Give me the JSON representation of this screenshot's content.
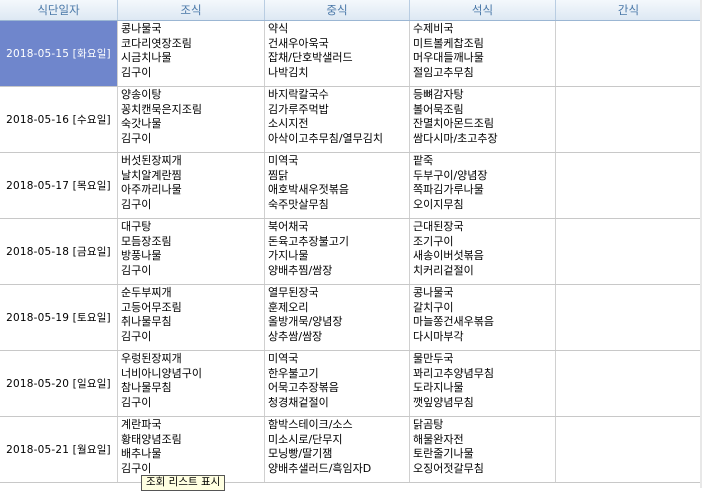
{
  "header": {
    "date": "식단일자",
    "breakfast": "조식",
    "lunch": "중식",
    "dinner": "석식",
    "snack": "간식"
  },
  "rows": [
    {
      "date": "2018-05-15 [화요일]",
      "breakfast": [
        "콩나물국",
        "코다리엿장조림",
        "시금치나물",
        "김구이"
      ],
      "lunch": [
        "약식",
        "건새우아욱국",
        "잡채/단호박샐러드",
        "나박김치"
      ],
      "dinner": [
        "수제비국",
        "미트볼케찹조림",
        "머우대들깨나물",
        "절임고추무침"
      ],
      "snack": []
    },
    {
      "date": "2018-05-16 [수요일]",
      "breakfast": [
        "양송이탕",
        "꽁치캔묵은지조림",
        "숙갓나물",
        "김구이"
      ],
      "lunch": [
        "바지락칼국수",
        "김가루주먹밥",
        "소시지전",
        "아삭이고추무침/열무김치"
      ],
      "dinner": [
        "등뼈감자탕",
        "볼어묵조림",
        "잔멸치아몬드조림",
        "쌈다시마/초고추장"
      ],
      "snack": []
    },
    {
      "date": "2018-05-17 [목요일]",
      "breakfast": [
        "버섯된장찌개",
        "날치알계란찜",
        "아주까리나물",
        "김구이"
      ],
      "lunch": [
        "미역국",
        "찜닭",
        "애호박새우젓볶음",
        "숙주맛살무침"
      ],
      "dinner": [
        "팥죽",
        "두부구이/양념장",
        "쪽파김가루나물",
        "오이지무침"
      ],
      "snack": []
    },
    {
      "date": "2018-05-18 [금요일]",
      "breakfast": [
        "대구탕",
        "모듬장조림",
        "방풍나물",
        "김구이"
      ],
      "lunch": [
        "북어채국",
        "돈육고추장불고기",
        "가지나물",
        "양배추찜/쌈장"
      ],
      "dinner": [
        "근대된장국",
        "조기구이",
        "새송이버섯볶음",
        "치커리겉절이"
      ],
      "snack": []
    },
    {
      "date": "2018-05-19 [토요일]",
      "breakfast": [
        "순두부찌개",
        "고등어무조림",
        "취나물무침",
        "김구이"
      ],
      "lunch": [
        "열무된장국",
        "훈제오리",
        "올방개묵/양념장",
        "상추쌈/쌈장"
      ],
      "dinner": [
        "콩나물국",
        "갈치구이",
        "마늘쫑건새우볶음",
        "다시마부각"
      ],
      "snack": []
    },
    {
      "date": "2018-05-20 [일요일]",
      "breakfast": [
        "우렁된장찌개",
        "너비아니양념구이",
        "참나물무침",
        "김구이"
      ],
      "lunch": [
        "미역국",
        "한우불고기",
        "어묵고추장볶음",
        "청경채겉절이"
      ],
      "dinner": [
        "물만두국",
        "꽈리고추양념무침",
        "도라지나물",
        "깻잎양념무침"
      ],
      "snack": []
    },
    {
      "date": "2018-05-21 [월요일]",
      "breakfast": [
        "계란파국",
        "황태양념조림",
        "배추나물",
        "김구이"
      ],
      "lunch": [
        "함박스테이크/소스",
        "미소시로/단무지",
        "모닝빵/딸기잼",
        "양배추샐러드/흑임자D"
      ],
      "dinner": [
        "닭곰탕",
        "해물완자전",
        "토란줄기나물",
        "오징어젓갈무침"
      ],
      "snack": []
    }
  ],
  "tooltip": "조회 리스트 표시"
}
